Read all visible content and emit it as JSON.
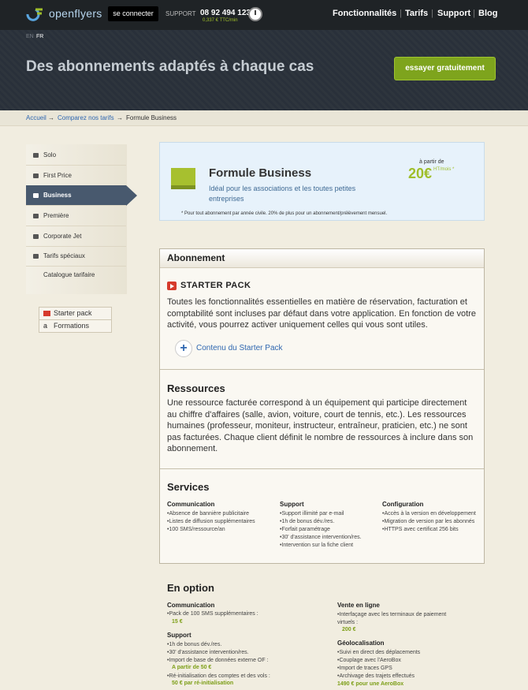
{
  "header": {
    "logo": "openflyers",
    "login": "se connecter",
    "support_label": "SUPPORT",
    "support_phone": "08 92 494 123",
    "support_price": "0,337 € TTC/min",
    "nav": [
      "Fonctionnalités",
      "Tarifs",
      "Support",
      "Blog"
    ],
    "lang_en": "EN",
    "lang_fr": "FR",
    "title": "Des abonnements adaptés à chaque cas",
    "cta": "essayer gratuitement"
  },
  "breadcrumb": {
    "home": "Accueil",
    "arrow1": "→",
    "compare": "Comparez nos tarifs",
    "arrow2": "→",
    "current": "Formule Business"
  },
  "sidebar": {
    "items": [
      "Solo",
      "First Price",
      "Business",
      "Première",
      "Corporate Jet",
      "Tarifs spéciaux",
      "Catalogue tarifaire"
    ],
    "boxes": [
      "Starter pack",
      "Formations"
    ]
  },
  "banner": {
    "title": "Formule Business",
    "subtitle": "Idéal pour les associations et les toutes petites entreprises",
    "apartir": "à partir de",
    "price": "20€",
    "unit": "HT/mois *",
    "note": "* Pour tout abonnement par année civile. 20% de plus pour un abonnement/prélèvement mensuel."
  },
  "abonnement": {
    "heading": "Abonnement",
    "starter": "STARTER PACK",
    "text": "Toutes les fonctionnalités essentielles en matière de réservation, facturation et comptabilité sont incluses par défaut dans votre application. En fonction de votre activité, vous pourrez activer uniquement celles qui vous sont utiles.",
    "plus": "+",
    "link": "Contenu du Starter Pack"
  },
  "ressources": {
    "heading": "Ressources",
    "text": "Une ressource facturée correspond à un équipement qui participe directement au chiffre d'affaires (salle, avion, voiture, court de tennis, etc.). Les ressources humaines (professeur, moniteur, instructeur, entraîneur, praticien, etc.) ne sont pas facturées. Chaque client définit le nombre de ressources à inclure dans son abonnement."
  },
  "services": {
    "heading": "Services",
    "communication": {
      "title": "Communication",
      "items": [
        "Absence de bannière publicitaire",
        "Listes de diffusion supplémentaires",
        "100 SMS/ressource/an"
      ]
    },
    "support": {
      "title": "Support",
      "items": [
        "Support illimité par e-mail",
        "1h de bonus dév./res.",
        "Forfait paramétrage",
        "30' d'assistance intervention/res.",
        "Intervention sur la fiche client"
      ]
    },
    "configuration": {
      "title": "Configuration",
      "items": [
        "Accès à la version en développement",
        "Migration de version par les abonnés",
        "HTTPS avec certificat 256 bits"
      ]
    }
  },
  "option": {
    "heading": "En option",
    "communication": {
      "title": "Communication",
      "items": [
        "Pack de 100 SMS supplémentaires :"
      ],
      "price": "15 €"
    },
    "support": {
      "title": "Support",
      "items": [
        "1h de bonus dév./res.",
        "30' d'assistance intervention/res.",
        "Import de base de données externe OF :"
      ],
      "price1": "A partir de 50 €",
      "item4": "Ré-initialisation des comptes et des vols :",
      "price2": "50 € par ré-initialisation"
    },
    "vente": {
      "title": "Vente en ligne",
      "items": [
        "Interfaçage avec les terminaux de paiement virtuels :"
      ],
      "price": "200 €"
    },
    "geo": {
      "title": "Géolocalisation",
      "items": [
        "Suivi en direct des déplacements",
        "Couplage avec l'AeroBox",
        "Import de traces GPS",
        "Archivage des trajets effectués"
      ],
      "price": "1490 € pour une AeroBox"
    }
  }
}
